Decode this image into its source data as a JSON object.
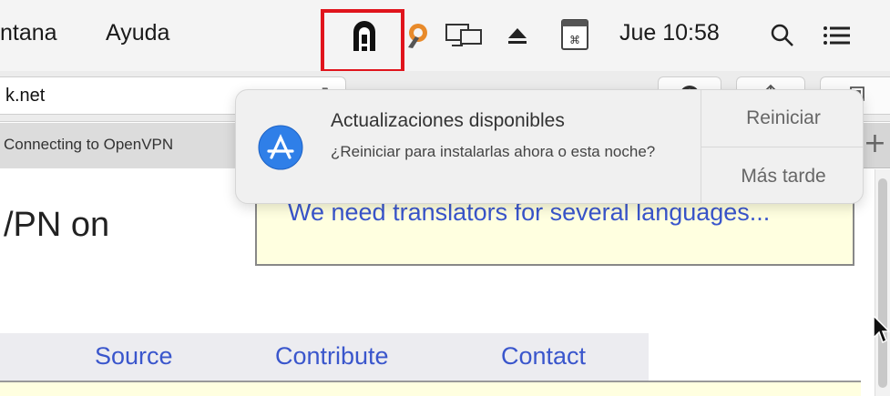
{
  "menubar": {
    "menus": [
      "ntana",
      "Ayuda"
    ],
    "clock": "Jue 10:58",
    "icons": [
      "vpn-icon",
      "tunnelblick-icon",
      "screen-mirroring-icon",
      "eject-icon",
      "keyboard-input-icon",
      "spotlight-search-icon",
      "notification-center-icon"
    ]
  },
  "browser": {
    "address": "k.net",
    "tab_title": "Connecting to OpenVPN"
  },
  "page": {
    "heading": "/PN on",
    "notice": "We need translators for several languages...",
    "nav": [
      "Source",
      "Contribute",
      "Contact"
    ]
  },
  "notification": {
    "title": "Actualizaciones disponibles",
    "body": "¿Reiniciar para instalarlas ahora o esta noche?",
    "primary_action": "Reiniciar",
    "secondary_action": "Más tarde",
    "accent_color": "#2f7fe8"
  },
  "highlight_color": "#e0141c"
}
